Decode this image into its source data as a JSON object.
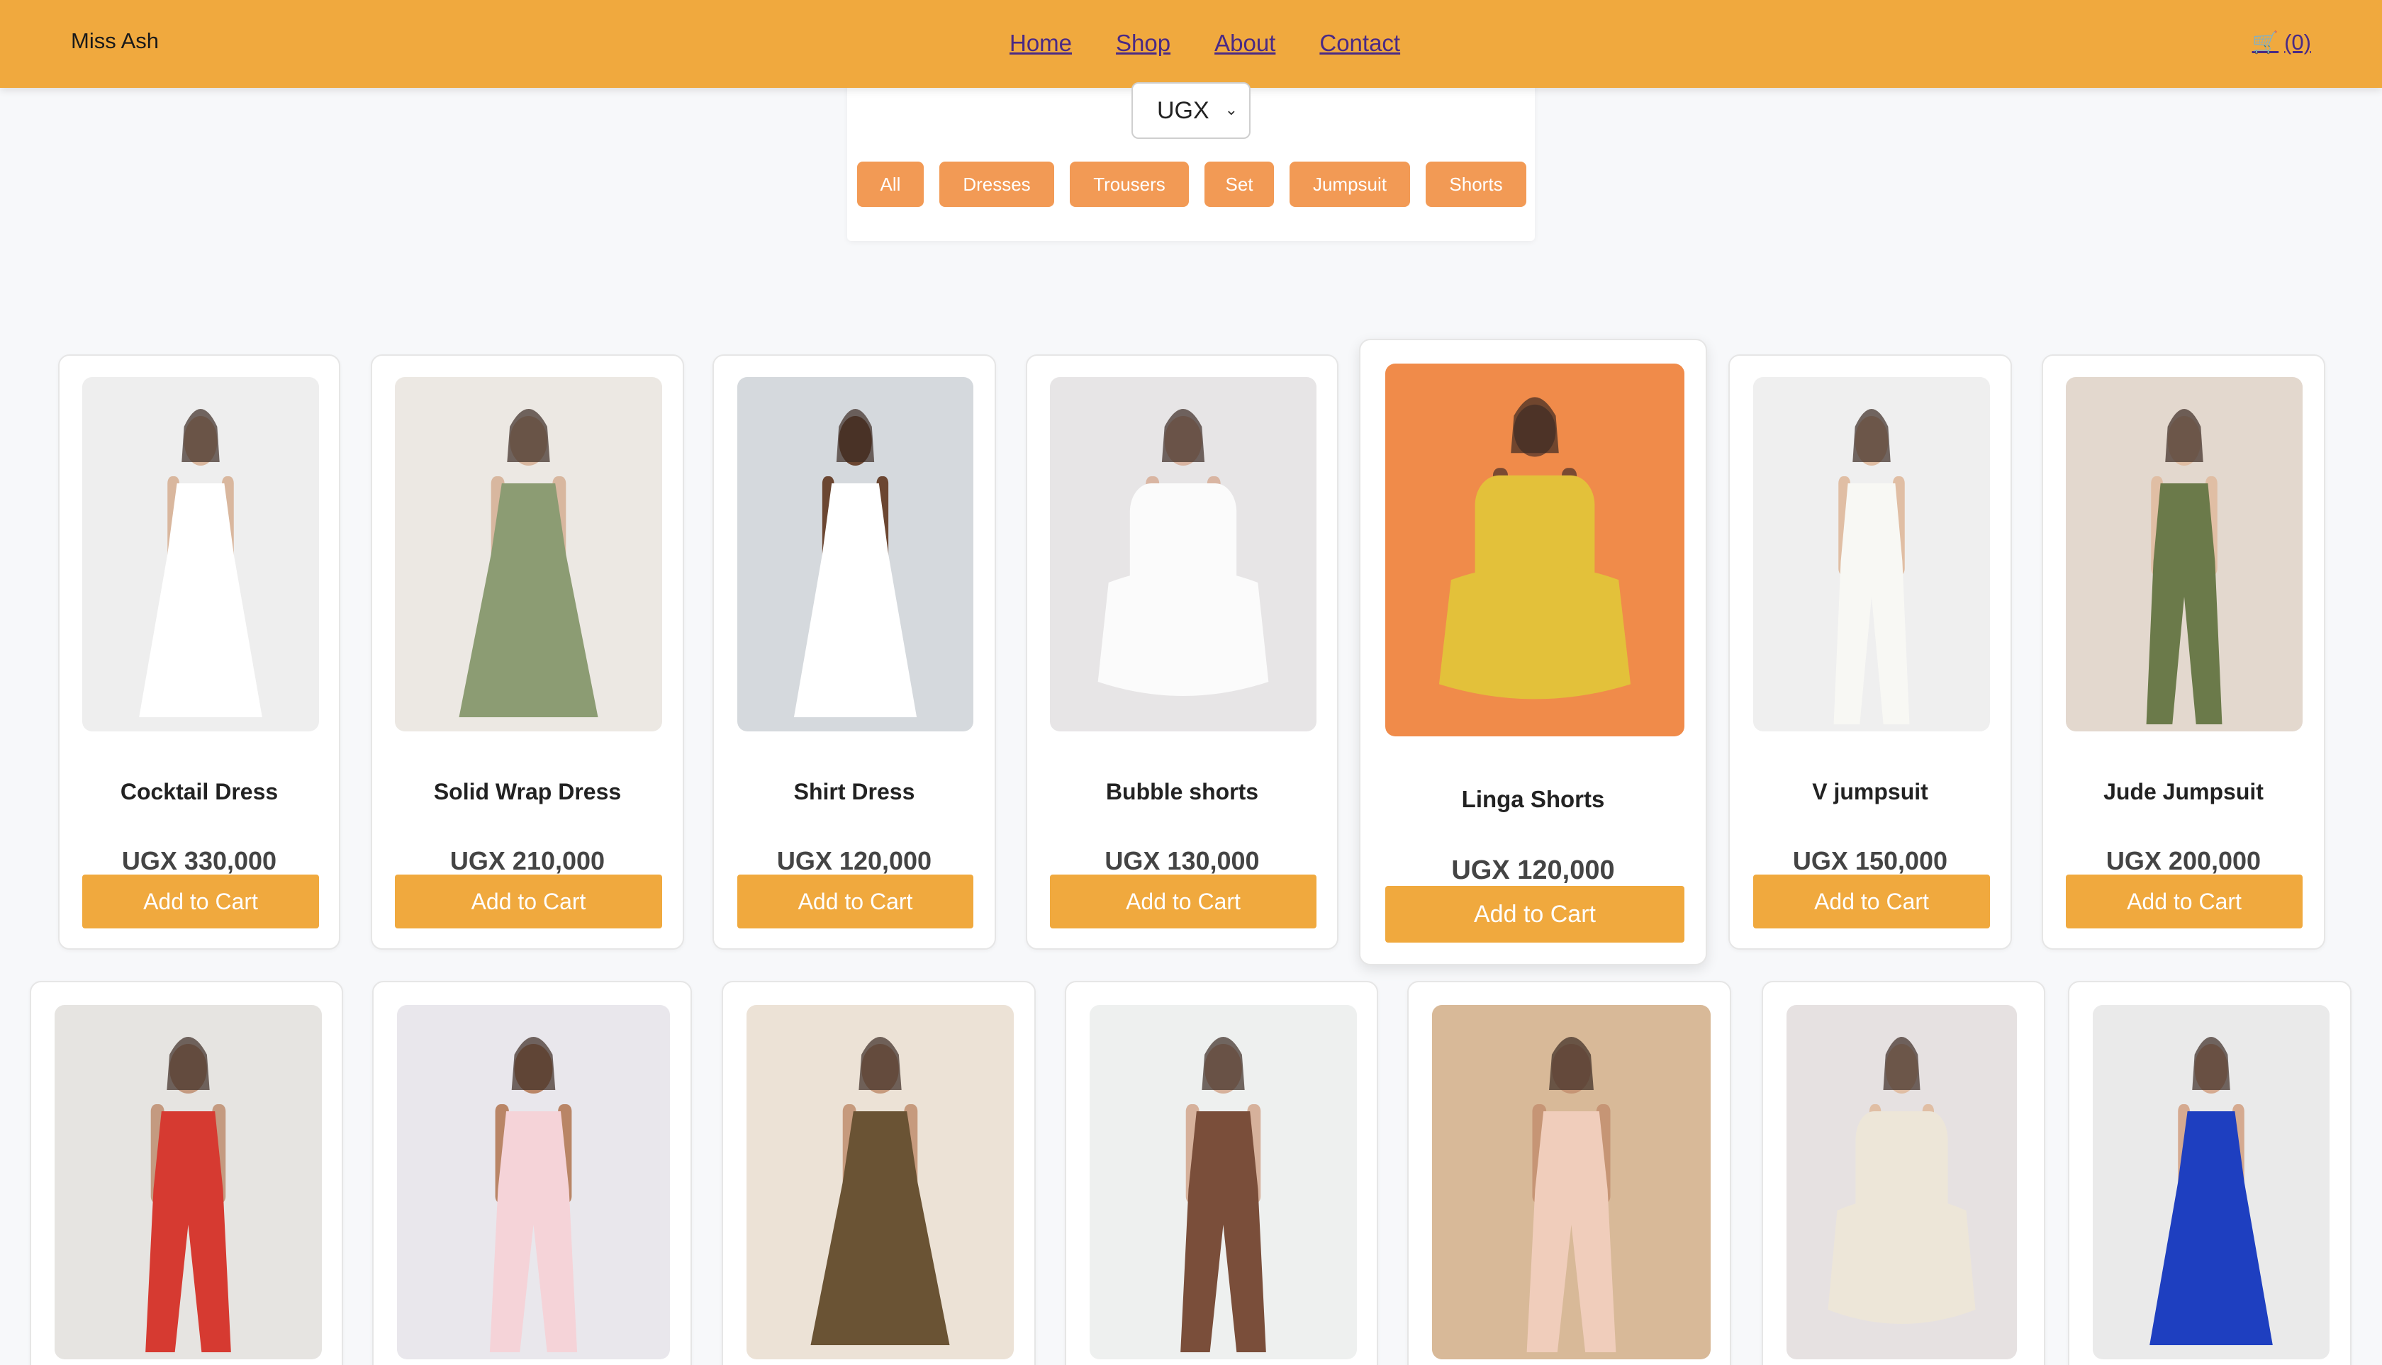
{
  "header": {
    "brand": "Miss Ash",
    "nav": [
      "Home",
      "Shop",
      "About",
      "Contact"
    ],
    "cart_icon": "🛒",
    "cart_count": "(0)"
  },
  "currency": {
    "selected": "UGX"
  },
  "filters": [
    "All",
    "Dresses",
    "Trousers",
    "Set",
    "Jumpsuit",
    "Shorts"
  ],
  "add_to_cart_label": "Add to Cart",
  "products": [
    {
      "name": "Cocktail Dress",
      "price": "UGX 330,000",
      "bg": "#eeeeee",
      "garment": "#ffffff",
      "skin": "#d9b79e"
    },
    {
      "name": "Solid Wrap Dress",
      "price": "UGX 210,000",
      "bg": "#ece8e3",
      "garment": "#8c9c73",
      "skin": "#d8b79f"
    },
    {
      "name": "Shirt Dress",
      "price": "UGX 120,000",
      "bg": "#d5d9dd",
      "garment": "#ffffff",
      "skin": "#6b4631"
    },
    {
      "name": "Bubble shorts",
      "price": "UGX 130,000",
      "bg": "#e7e5e6",
      "garment": "#fbfbfb",
      "skin": "#d9b5a2"
    },
    {
      "name": "Linga Shorts",
      "price": "UGX 120,000",
      "bg": "#f08b4a",
      "garment": "#e3c13a",
      "skin": "#7a4a32"
    },
    {
      "name": "V jumpsuit",
      "price": "UGX 150,000",
      "bg": "#efefef",
      "garment": "#f8f8f4",
      "skin": "#e0bea4"
    },
    {
      "name": "Jude Jumpsuit",
      "price": "UGX 200,000",
      "bg": "#e3d8ce",
      "garment": "#6b7a4a",
      "skin": "#e0bea4"
    }
  ],
  "row2_products": [
    {
      "bg": "#e6e4e1",
      "garment": "#d63a31",
      "skin": "#c49a80"
    },
    {
      "bg": "#e9e7ec",
      "garment": "#f5d3d8",
      "skin": "#b98566"
    },
    {
      "bg": "#ece2d6",
      "garment": "#6a5334",
      "skin": "#c69a7d"
    },
    {
      "bg": "#eef0ef",
      "garment": "#7a4e3a",
      "skin": "#d6b19b"
    },
    {
      "bg": "#d8b998",
      "garment": "#f0cdbb",
      "skin": "#c69575"
    },
    {
      "bg": "#e6e1e1",
      "garment": "#ede6d8",
      "skin": "#e0bea4"
    },
    {
      "bg": "#eaeaea",
      "garment": "#1e3fc0",
      "skin": "#d5aa90"
    }
  ]
}
